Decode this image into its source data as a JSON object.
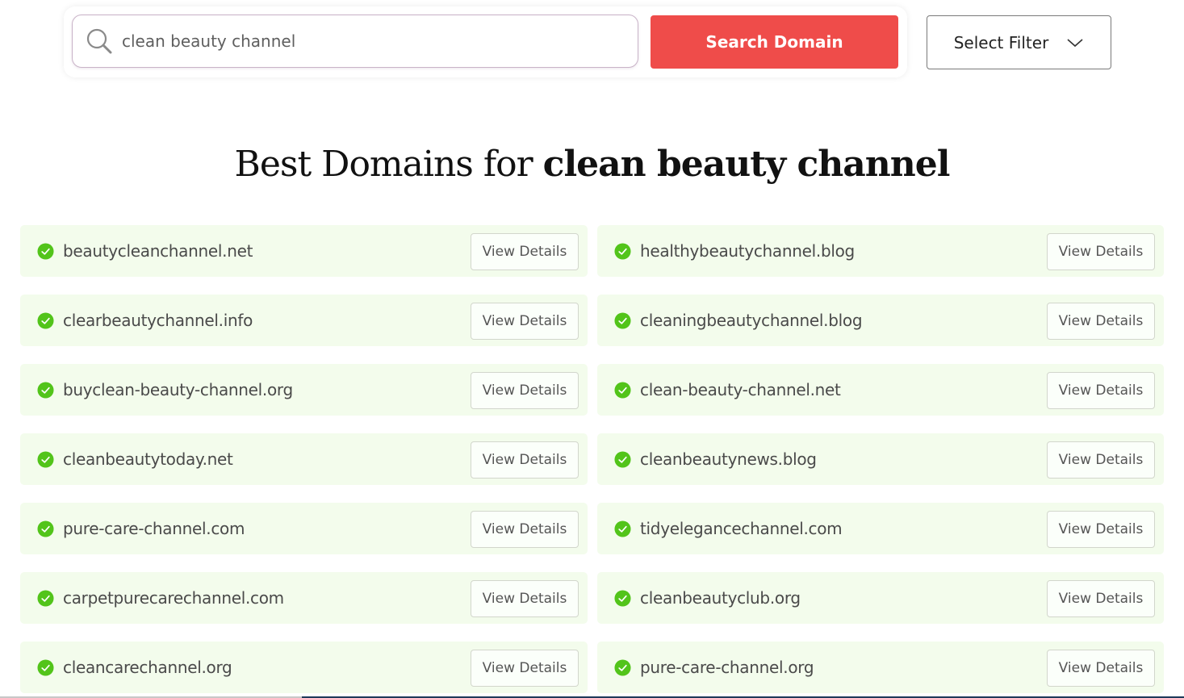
{
  "search": {
    "query": "clean beauty channel",
    "button_label": "Search Domain",
    "icon": "search-icon"
  },
  "filter": {
    "label": "Select Filter",
    "icon": "chevron-down-icon"
  },
  "heading": {
    "prefix": "Best Domains for ",
    "keyword": "clean beauty channel"
  },
  "colors": {
    "accent": "#ef4c4a",
    "available": "#52c41a",
    "row_background": "#f3fcec"
  },
  "results": [
    {
      "domain": "beautycleanchannel.net",
      "button": "View Details",
      "status": "available"
    },
    {
      "domain": "healthybeautychannel.blog",
      "button": "View Details",
      "status": "available"
    },
    {
      "domain": "clearbeautychannel.info",
      "button": "View Details",
      "status": "available"
    },
    {
      "domain": "cleaningbeautychannel.blog",
      "button": "View Details",
      "status": "available"
    },
    {
      "domain": "buyclean-beauty-channel.org",
      "button": "View Details",
      "status": "available"
    },
    {
      "domain": "clean-beauty-channel.net",
      "button": "View Details",
      "status": "available"
    },
    {
      "domain": "cleanbeautytoday.net",
      "button": "View Details",
      "status": "available"
    },
    {
      "domain": "cleanbeautynews.blog",
      "button": "View Details",
      "status": "available"
    },
    {
      "domain": "pure-care-channel.com",
      "button": "View Details",
      "status": "available"
    },
    {
      "domain": "tidyelegancechannel.com",
      "button": "View Details",
      "status": "available"
    },
    {
      "domain": "carpetpurecarechannel.com",
      "button": "View Details",
      "status": "available"
    },
    {
      "domain": "cleanbeautyclub.org",
      "button": "View Details",
      "status": "available"
    },
    {
      "domain": "cleancarechannel.org",
      "button": "View Details",
      "status": "available"
    },
    {
      "domain": "pure-care-channel.org",
      "button": "View Details",
      "status": "available"
    }
  ]
}
